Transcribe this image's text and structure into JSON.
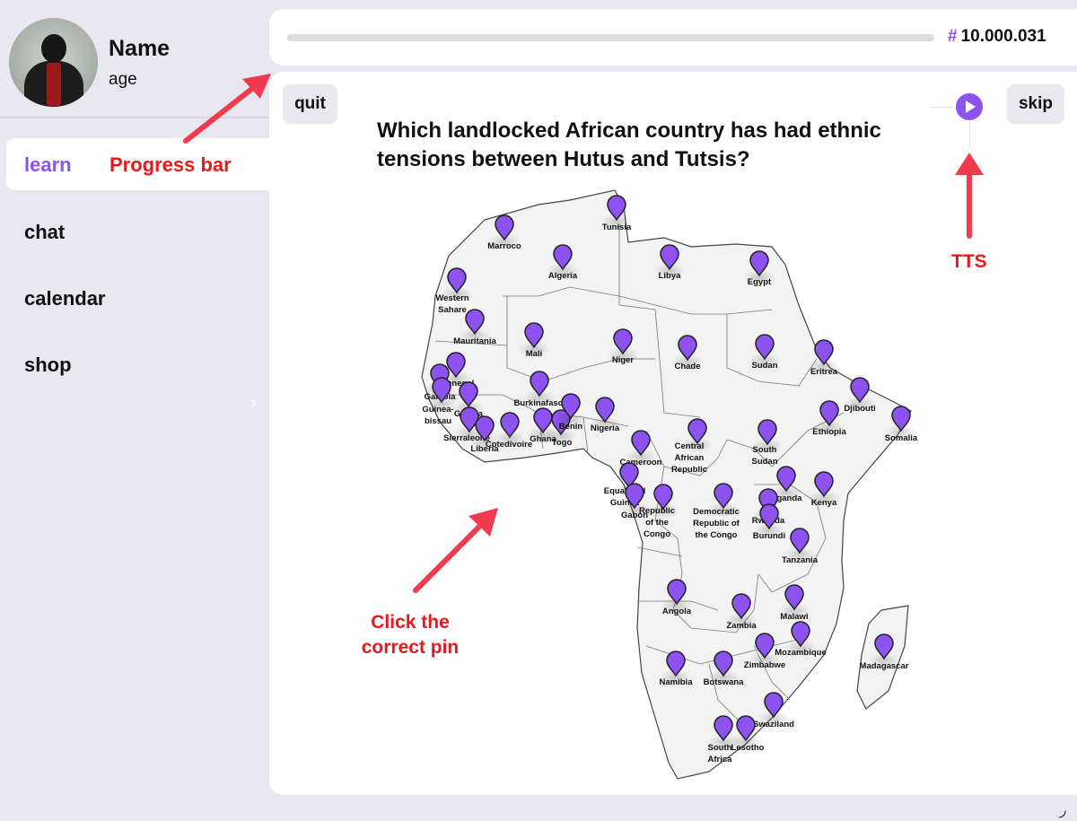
{
  "profile": {
    "name": "Name",
    "age": "age"
  },
  "nav": {
    "items": [
      "learn",
      "chat",
      "calendar",
      "shop"
    ],
    "active": "learn",
    "chevron": "›"
  },
  "progress": {
    "value_percent": 0,
    "points_prefix": "#",
    "points": "10.000.031"
  },
  "quiz": {
    "quit_label": "quit",
    "skip_label": "skip",
    "question": "Which landlocked African country has had ethnic tensions between Hutus and Tutsis?"
  },
  "annotations": {
    "progress": "Progress bar",
    "tts": "TTS",
    "click": "Click the correct pin"
  },
  "map": {
    "countries": [
      "Marroco",
      "Tunisia",
      "Algeria",
      "Libya",
      "Egypt",
      "Western Sahare",
      "Mauritania",
      "Mali",
      "Niger",
      "Chade",
      "Sudan",
      "Eritrea",
      "Senegal",
      "Gambia",
      "Guinea-bissau",
      "Guinea",
      "Sierraleone",
      "Liberia",
      "Cotedivoire",
      "Burkinafaso",
      "Ghana",
      "Togo",
      "Benin",
      "Nigeria",
      "Cameroon",
      "Central African Republic",
      "South Sudan",
      "Djibouti",
      "Ethiopia",
      "Somalia",
      "Equatorial Guinea",
      "Gabon",
      "Republic of the Congo",
      "Democratic Republic of the Congo",
      "Uganda",
      "Rwanda",
      "Burundi",
      "Kenya",
      "Tanzania",
      "Angola",
      "Zambia",
      "Malawi",
      "Mozambique",
      "Zimbabwe",
      "Madagascar",
      "Namibia",
      "Botswana",
      "Swaziland",
      "South Africa",
      "Lesotho"
    ]
  },
  "colors": {
    "accent": "#8d52f0",
    "annotation": "#e8181c",
    "background": "#e9e8f0"
  }
}
